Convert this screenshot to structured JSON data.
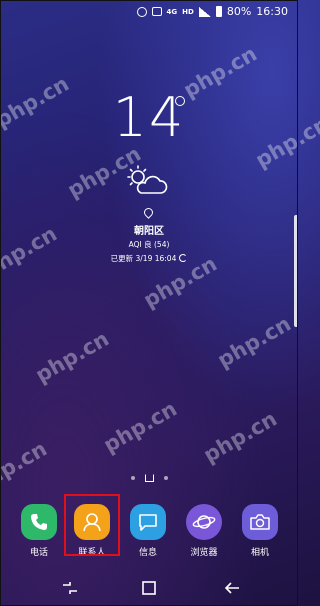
{
  "status_bar": {
    "battery": "80%",
    "time": "16:30",
    "tag_a": "4G",
    "tag_b": "HD"
  },
  "weather": {
    "temperature": "14",
    "location": "朝阳区",
    "aqi": "AQI 良 (54)",
    "updated": "已更新 3/19 16:04",
    "icon": "partly-cloudy-icon"
  },
  "watermark": "php.cn",
  "dock": {
    "apps": [
      {
        "label": "电话",
        "color": "#2db86a",
        "icon": "phone-icon"
      },
      {
        "label": "联系人",
        "color": "#f5a21b",
        "icon": "contacts-icon"
      },
      {
        "label": "信息",
        "color": "#2d9fe3",
        "icon": "messages-icon"
      },
      {
        "label": "浏览器",
        "color": "#7a57d9",
        "icon": "browser-icon"
      },
      {
        "label": "相机",
        "color": "#6d5dd8",
        "icon": "camera-icon"
      }
    ],
    "highlight_color": "#e0101b"
  },
  "navbar": {
    "buttons": [
      "recent-apps-icon",
      "home-icon",
      "back-icon"
    ]
  }
}
